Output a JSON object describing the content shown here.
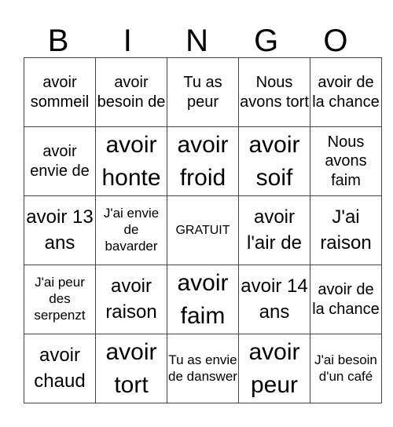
{
  "header": {
    "letters": [
      "B",
      "I",
      "N",
      "G",
      "O"
    ]
  },
  "grid": [
    [
      "avoir sommeil",
      "avoir besoin de",
      "Tu as peur",
      "Nous avons tort",
      "avoir de la chance"
    ],
    [
      "avoir envie de",
      "avoir honte",
      "avoir froid",
      "avoir soif",
      "Nous avons faim"
    ],
    [
      "avoir 13 ans",
      "J'ai envie de bavarder",
      "GRATUIT",
      "avoir l'air de",
      "J'ai raison"
    ],
    [
      "J'ai peur des serpenzt",
      "avoir raison",
      "avoir faim",
      "avoir 14 ans",
      "avoir de la chance"
    ],
    [
      "avoir chaud",
      "avoir tort",
      "Tu as envie de danswer",
      "avoir peur",
      "J'ai besoin d'un café"
    ]
  ]
}
